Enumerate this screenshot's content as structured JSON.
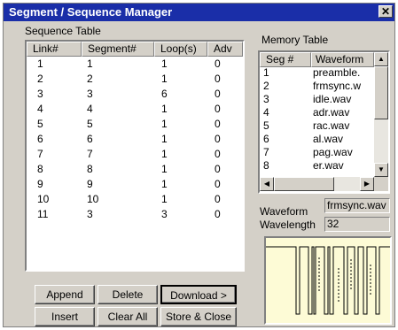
{
  "window": {
    "title": "Segment / Sequence Manager",
    "close_glyph": "✕"
  },
  "sequence_table": {
    "label": "Sequence Table",
    "columns": [
      "Link#",
      "Segment#",
      "Loop(s)",
      "Adv"
    ],
    "rows": [
      [
        "1",
        "1",
        "1",
        "0"
      ],
      [
        "2",
        "2",
        "1",
        "0"
      ],
      [
        "3",
        "3",
        "6",
        "0"
      ],
      [
        "4",
        "4",
        "1",
        "0"
      ],
      [
        "5",
        "5",
        "1",
        "0"
      ],
      [
        "6",
        "6",
        "1",
        "0"
      ],
      [
        "7",
        "7",
        "1",
        "0"
      ],
      [
        "8",
        "8",
        "1",
        "0"
      ],
      [
        "9",
        "9",
        "1",
        "0"
      ],
      [
        "10",
        "10",
        "1",
        "0"
      ],
      [
        "11",
        "3",
        "3",
        "0"
      ]
    ]
  },
  "memory_table": {
    "label": "Memory Table",
    "columns": [
      "Seg #",
      "Waveform"
    ],
    "rows": [
      [
        "1",
        "preamble."
      ],
      [
        "2",
        "frmsync.w"
      ],
      [
        "3",
        "idle.wav"
      ],
      [
        "4",
        "adr.wav"
      ],
      [
        "5",
        "rac.wav"
      ],
      [
        "6",
        "al.wav"
      ],
      [
        "7",
        "pag.wav"
      ],
      [
        "8",
        "er.wav"
      ]
    ]
  },
  "details": {
    "waveform_label": "Waveform",
    "waveform_value": "frmsync.wav",
    "wavelength_label": "Wavelength",
    "wavelength_value": "32"
  },
  "buttons": {
    "append": "Append",
    "delete": "Delete",
    "download": "Download >",
    "insert": "Insert",
    "clear_all": "Clear All",
    "store_close": "Store & Close"
  },
  "colors": {
    "titlebar": "#1a2ea8",
    "face": "#d4d0c8",
    "wave_bg": "#fdfbd6"
  }
}
